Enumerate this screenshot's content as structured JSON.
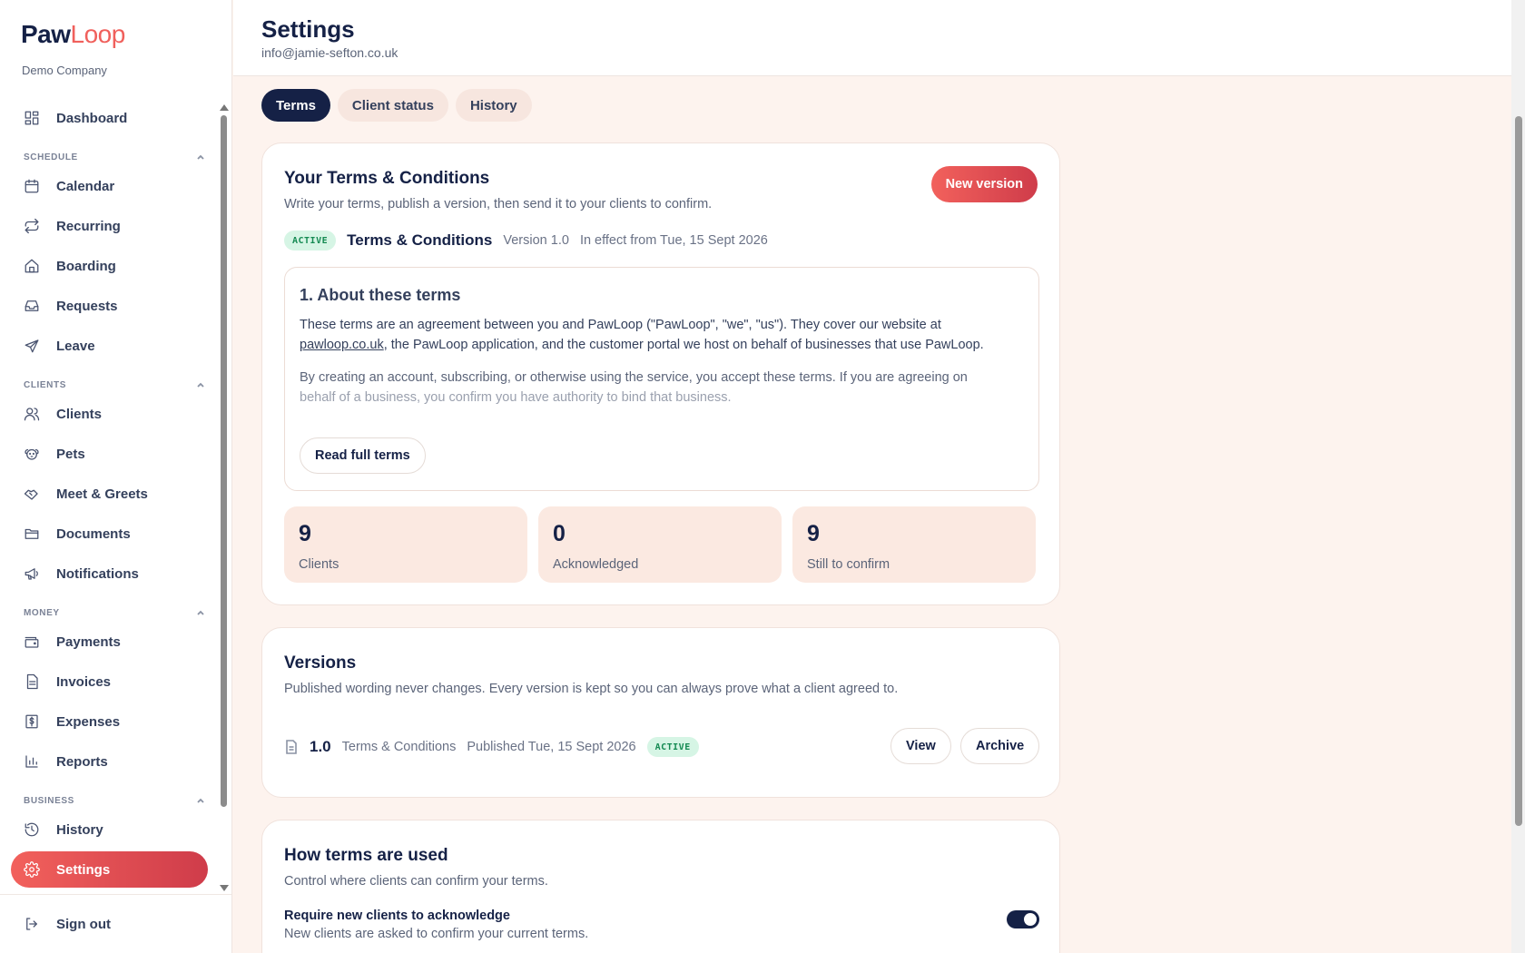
{
  "brand": {
    "name_part1": "Paw",
    "name_part2": "Loop",
    "company": "Demo Company"
  },
  "sidebar": {
    "dashboard": "Dashboard",
    "sections": {
      "schedule": "SCHEDULE",
      "clients": "CLIENTS",
      "money": "MONEY",
      "business": "BUSINESS"
    },
    "items": {
      "calendar": "Calendar",
      "recurring": "Recurring",
      "boarding": "Boarding",
      "requests": "Requests",
      "leave": "Leave",
      "clients": "Clients",
      "pets": "Pets",
      "meet_greets": "Meet & Greets",
      "documents": "Documents",
      "notifications": "Notifications",
      "payments": "Payments",
      "invoices": "Invoices",
      "expenses": "Expenses",
      "reports": "Reports",
      "history": "History",
      "settings": "Settings"
    },
    "sign_out": "Sign out"
  },
  "header": {
    "title": "Settings",
    "email": "info@jamie-sefton.co.uk"
  },
  "tabs": [
    {
      "label": "Terms",
      "active": true
    },
    {
      "label": "Client status",
      "active": false
    },
    {
      "label": "History",
      "active": false
    }
  ],
  "terms_card": {
    "title": "Your Terms & Conditions",
    "desc": "Write your terms, publish a version, then send it to your clients to confirm.",
    "new_version": "New version",
    "badge": "ACTIVE",
    "doc_title": "Terms & Conditions",
    "version": "Version 1.0",
    "effective": "In effect from Tue, 15 Sept 2026",
    "section_title": "1. About these terms",
    "para1_a": "These terms are an agreement between you and PawLoop (\"PawLoop\", \"we\", \"us\"). They cover our website at ",
    "para1_link": "pawloop.co.uk",
    "para1_b": ", the PawLoop application, and the customer portal we host on behalf of businesses that use PawLoop.",
    "para2_a": "By creating an account, subscribing, or otherwise using the service, you accept these terms. If you are agreeing on",
    "para2_b": "behalf of a business, you confirm you have authority to bind that business.",
    "read_full": "Read full terms",
    "stats": [
      {
        "value": "9",
        "label": "Clients"
      },
      {
        "value": "0",
        "label": "Acknowledged"
      },
      {
        "value": "9",
        "label": "Still to confirm"
      }
    ]
  },
  "versions_card": {
    "title": "Versions",
    "desc": "Published wording never changes. Every version is kept so you can always prove what a client agreed to.",
    "row": {
      "number": "1.0",
      "name": "Terms & Conditions",
      "published": "Published Tue, 15 Sept 2026",
      "badge": "ACTIVE",
      "view": "View",
      "archive": "Archive"
    }
  },
  "usage_card": {
    "title": "How terms are used",
    "desc": "Control where clients can confirm your terms.",
    "setting_title": "Require new clients to acknowledge",
    "setting_desc": "New clients are asked to confirm your current terms.",
    "toggle_on": true
  },
  "colors": {
    "navy": "#152146",
    "accent": "#f0605c",
    "active_badge_bg": "#d6f5e5",
    "active_badge_text": "#148a52"
  }
}
